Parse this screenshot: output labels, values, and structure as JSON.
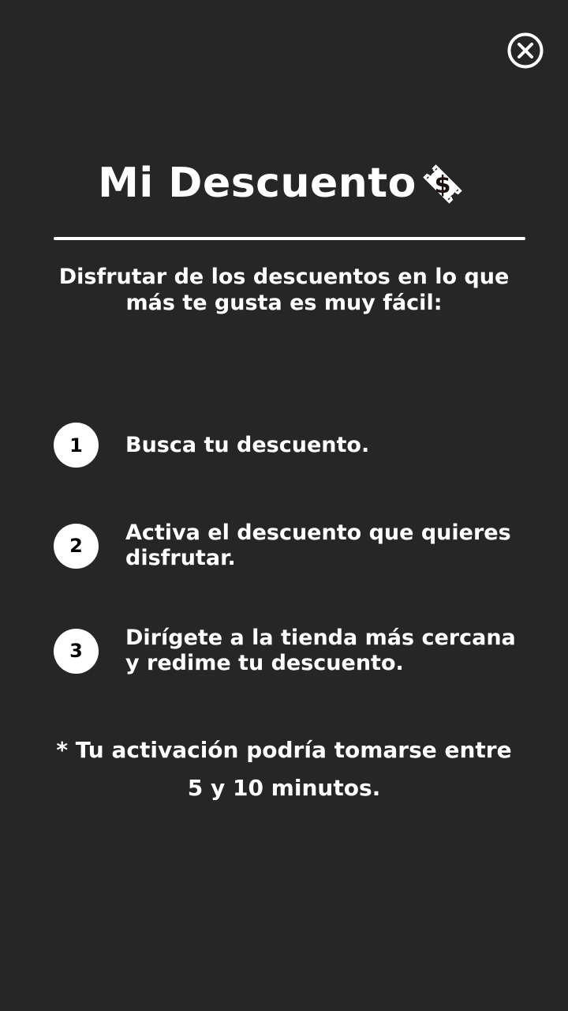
{
  "header": {
    "close_icon": "close-circle-icon",
    "title": "Mi Descuento",
    "title_icon": "discount-ticket-dollar-icon"
  },
  "intro": {
    "text": "Disfrutar de los descuentos en lo que más te gusta es muy fácil:"
  },
  "steps": [
    {
      "number": "1",
      "text": "Busca tu descuento."
    },
    {
      "number": "2",
      "text": "Activa el descuento que quieres disfrutar."
    },
    {
      "number": "3",
      "text": "Dirígete a la tienda más cercana y redime tu descuento."
    }
  ],
  "note": {
    "line1": "* Tu activación podría tomarse entre",
    "line2": "5 y 10 minutos."
  },
  "colors": {
    "background": "#262626",
    "foreground": "#ffffff",
    "step_number_text": "#000000"
  }
}
